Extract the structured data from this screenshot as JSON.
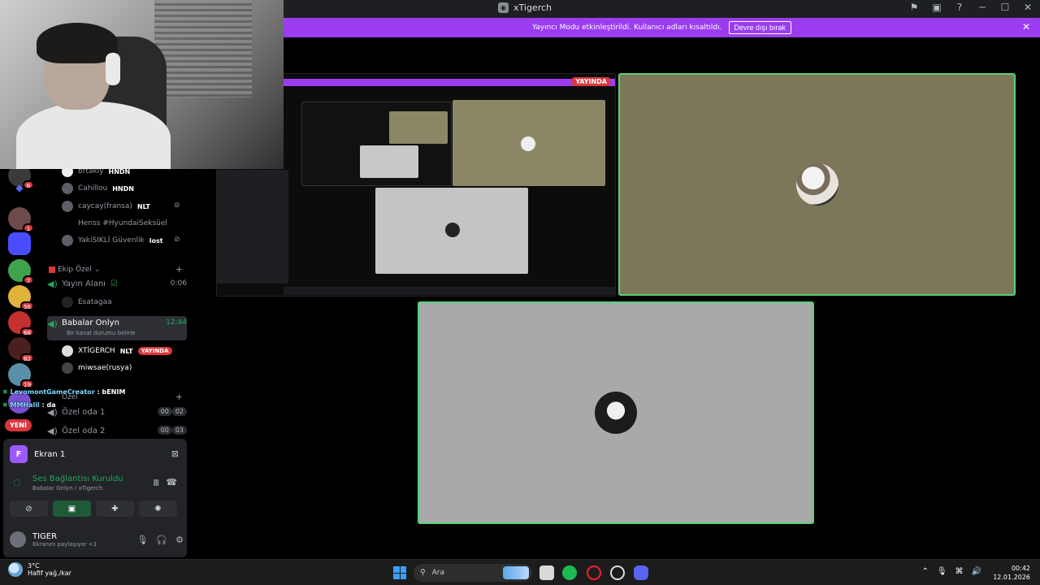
{
  "window": {
    "title": "xTigerch",
    "controls": [
      "─",
      "☐",
      "✕"
    ]
  },
  "banner": {
    "text": "Yayıncı Modu etkinleştirildi. Kullanıcı adları kısaltıldı.",
    "button": "Devre dışı bırak",
    "close": "✕"
  },
  "members": [
    {
      "name": "brtakly",
      "tag": "HNDN"
    },
    {
      "name": "Cahillou",
      "tag": "HNDN"
    },
    {
      "name": "caycay(fransa)",
      "tag": "NLT"
    },
    {
      "name": "Henss #HyundaiSeksüel",
      "tag": ""
    },
    {
      "name": "YakiSIKLİ Güvenlik",
      "tag": "lost"
    }
  ],
  "category": {
    "label": "Ekip Özel",
    "plus": "+"
  },
  "voice_channels": [
    {
      "name": "Yayın Alanı",
      "time": "0:06"
    },
    {
      "name": "Babalar Onlyn",
      "time": "12:44",
      "status": "Bir kanal durumu belirle"
    }
  ],
  "yayin_member": "Esatagaa",
  "babalar_members": [
    {
      "name": "XTİGERCH",
      "tag": "NLT",
      "live": "YAYINDA"
    },
    {
      "name": "miwsae(rusya)"
    }
  ],
  "ozel": {
    "category": "Özel",
    "rooms": [
      {
        "name": "Özel oda 1",
        "count_a": "00",
        "count_b": "02"
      },
      {
        "name": "Özel oda 2",
        "count_a": "00",
        "count_b": "03"
      }
    ]
  },
  "chat_overlay": [
    {
      "user": "LevomontGameCreator",
      "msg": " : bENIM"
    },
    {
      "user": "MMHalil",
      "msg": " : da"
    }
  ],
  "server_badges": [
    "6",
    "1",
    "7",
    "56",
    "66",
    "82",
    "19"
  ],
  "new_label": "YENİ",
  "panel": {
    "screen_label": "Ekran 1",
    "screen_initial": "F",
    "status": "Ses Bağlantısı Kuruldu",
    "sub": "Babalar Onlyn / xTigerch",
    "user": "TIGER",
    "user_status": "Ekranını paylaşıyor +1"
  },
  "stream": {
    "live_badge": "YAYINDA"
  },
  "taskbar": {
    "temp": "3°C",
    "weather": "Hafif yağ./kar",
    "search_placeholder": "Ara",
    "time": "00:42",
    "date": "12.01.2026"
  },
  "colors": {
    "accent": "#9b3cf0",
    "live": "#da373c",
    "speaking": "#57d07a",
    "online": "#23a55a"
  }
}
